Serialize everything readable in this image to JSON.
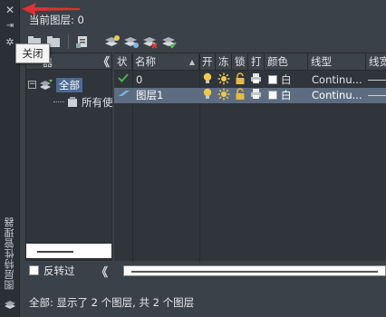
{
  "palette": {
    "title": "图层特性管理器",
    "current_layer_label": "当前图层: 0",
    "close_tooltip": "关闭"
  },
  "toolbar": {
    "icons": [
      "new-filter-icon",
      "group-filter-icon",
      "state-manager-icon",
      "new-layer-icon",
      "new-layer-vp-frozen-icon",
      "delete-layer-icon",
      "set-current-icon"
    ]
  },
  "tree": {
    "header_label": "器",
    "collapse_glyph": "《",
    "nodes": [
      {
        "label": "全部",
        "selected": true
      },
      {
        "label": "所有使"
      }
    ]
  },
  "list": {
    "columns": [
      "状",
      "名称",
      "开",
      "冻",
      "锁",
      "打",
      "颜色",
      "线型",
      "线宽"
    ],
    "rows": [
      {
        "status": "current",
        "name": "0",
        "color_name": "白",
        "linetype": "Continu...",
        "selected": false
      },
      {
        "status": "layer",
        "name": "图层1",
        "color_name": "白",
        "linetype": "Continu...",
        "selected": true
      }
    ]
  },
  "filter": {
    "invert_label": "反转过",
    "collapse_glyph": "《"
  },
  "status": {
    "text": "全部: 显示了 2 个图层, 共 2 个图层"
  },
  "colors": {
    "background": "#3b4148",
    "selection": "#5d6c80",
    "tree_selection": "#4a6a93",
    "bulb": "#f2c94c",
    "lock": "#e8b84a",
    "check": "#4caf50",
    "arrow": "#e03030"
  }
}
